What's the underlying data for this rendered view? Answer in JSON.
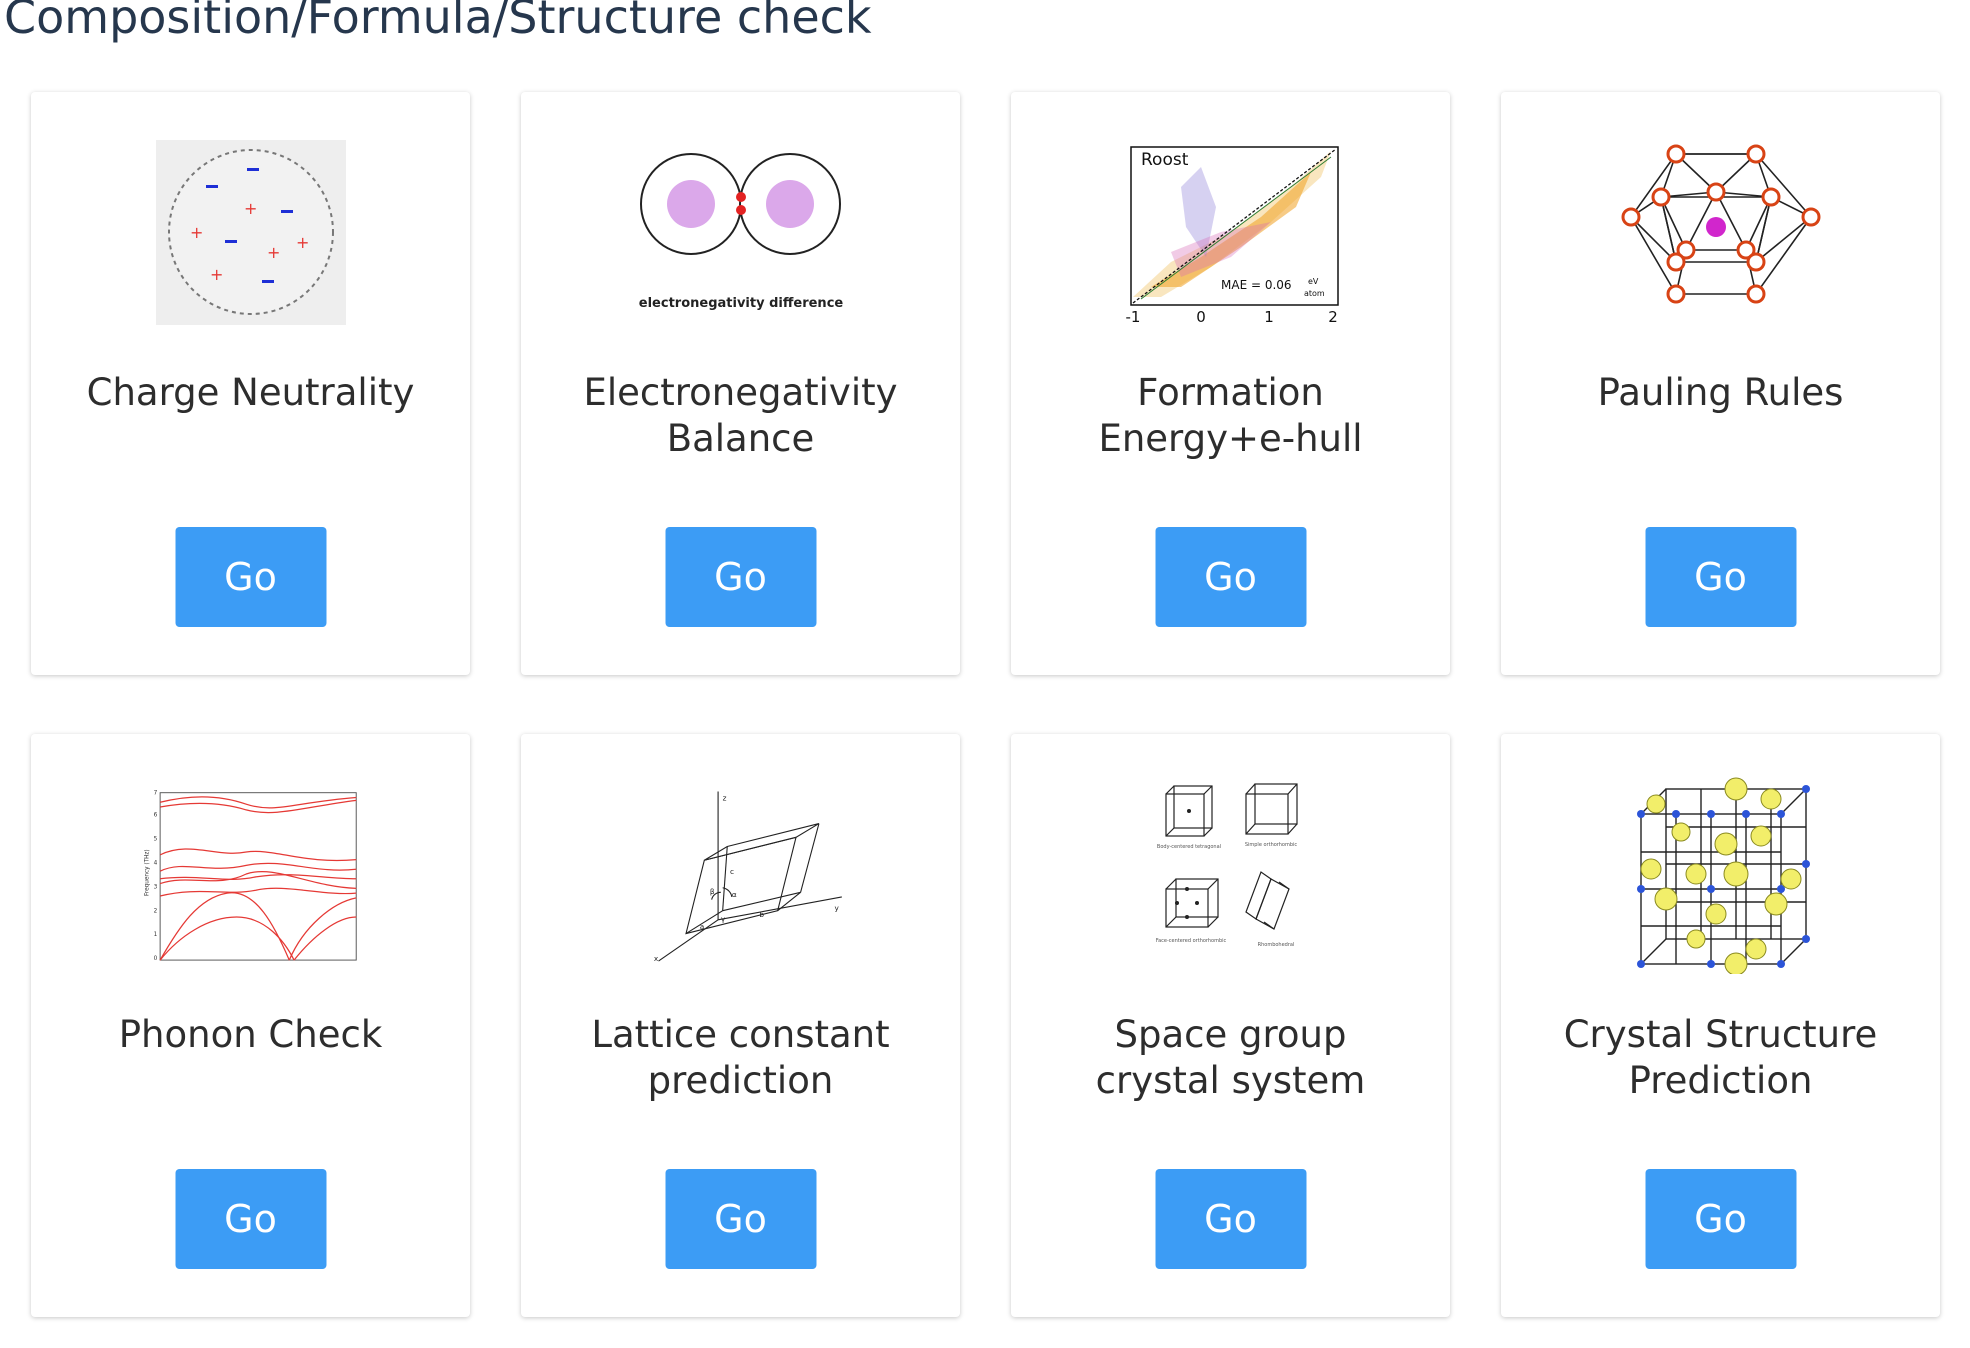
{
  "page": {
    "title": "Composition/Formula/Structure check"
  },
  "cards": [
    {
      "title": "Charge Neutrality",
      "button": "Go",
      "icon": "charge-neutrality-illustration"
    },
    {
      "title": "Electronegativity\nBalance",
      "button": "Go",
      "icon": "electronegativity-illustration",
      "caption": "electronegativity difference"
    },
    {
      "title": "Formation\nEnergy+e-hull",
      "button": "Go",
      "icon": "roost-parity-plot",
      "plot": {
        "label": "Roost",
        "mae": "MAE = 0.06",
        "mae_unit_num": "eV",
        "mae_unit_den": "atom",
        "ticks": [
          "-1",
          "0",
          "1",
          "2"
        ]
      }
    },
    {
      "title": "Pauling Rules",
      "button": "Go",
      "icon": "pauling-polyhedron-illustration"
    },
    {
      "title": "Phonon Check",
      "button": "Go",
      "icon": "phonon-dispersion-plot",
      "plot": {
        "ylabel": "Frequency (THz)",
        "yticks": [
          "0",
          "1",
          "2",
          "3",
          "4",
          "5",
          "6",
          "7"
        ]
      }
    },
    {
      "title": "Lattice constant\nprediction",
      "button": "Go",
      "icon": "lattice-parameters-illustration",
      "labels": {
        "z": "z",
        "y": "y",
        "x": "x",
        "a": "a",
        "b": "b",
        "c": "c",
        "alpha": "α",
        "beta": "β",
        "gamma": "γ"
      }
    },
    {
      "title": "Space group\ncrystal system",
      "button": "Go",
      "icon": "crystal-systems-illustration",
      "captions": [
        "Body-centered tetragonal",
        "Simple orthorhombic",
        "Face-centered orthorhombic",
        "Rhombohedral"
      ]
    },
    {
      "title": "Crystal Structure\nPrediction",
      "button": "Go",
      "icon": "crystal-structure-illustration"
    }
  ],
  "colors": {
    "button": "#3c9cf5",
    "title": "#26374d",
    "positive_charge": "#e53935",
    "negative_charge": "#1e2fd6"
  }
}
